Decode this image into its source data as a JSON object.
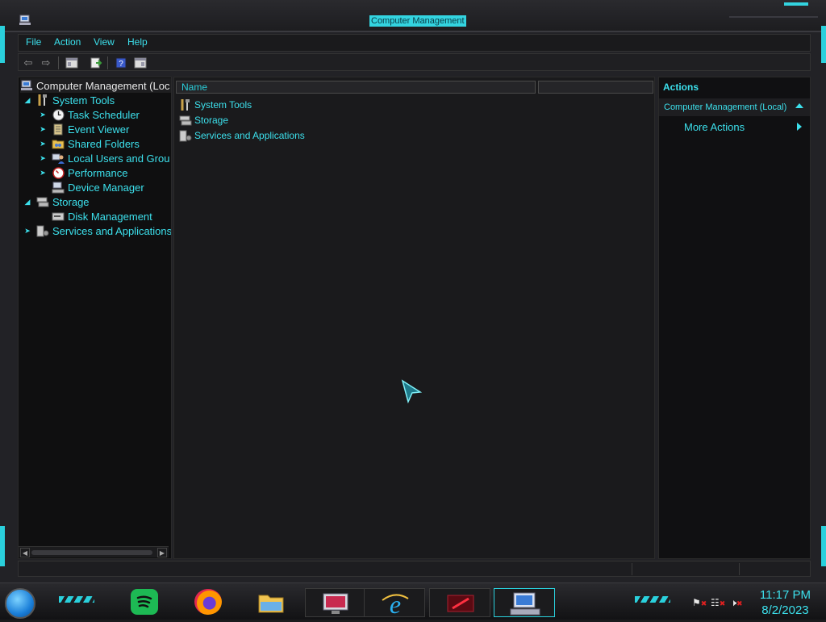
{
  "window": {
    "title": "Computer Management"
  },
  "menu": [
    "File",
    "Action",
    "View",
    "Help"
  ],
  "toolbar": {
    "icons": [
      "back-arrow-icon",
      "forward-arrow-icon",
      "show-hide-console-tree-icon",
      "export-list-icon",
      "help-icon",
      "show-hide-action-pane-icon"
    ]
  },
  "tree": {
    "root": "Computer Management (Loc",
    "items": [
      {
        "label": "System Tools",
        "level": 1,
        "expander": "expanded"
      },
      {
        "label": "Task Scheduler",
        "level": 2,
        "expander": "collapsed"
      },
      {
        "label": "Event Viewer",
        "level": 2,
        "expander": "collapsed"
      },
      {
        "label": "Shared Folders",
        "level": 2,
        "expander": "collapsed"
      },
      {
        "label": "Local Users and Grou",
        "level": 2,
        "expander": "collapsed"
      },
      {
        "label": "Performance",
        "level": 2,
        "expander": "collapsed"
      },
      {
        "label": "Device Manager",
        "level": 2,
        "expander": "none"
      },
      {
        "label": "Storage",
        "level": 1,
        "expander": "expanded"
      },
      {
        "label": "Disk Management",
        "level": 2,
        "expander": "none"
      },
      {
        "label": "Services and Applications",
        "level": 1,
        "expander": "collapsed"
      }
    ]
  },
  "list": {
    "column_name": "Name",
    "items": [
      "System Tools",
      "Storage",
      "Services and Applications"
    ]
  },
  "actions": {
    "title": "Actions",
    "section": "Computer Management (Local)",
    "more": "More Actions"
  },
  "taskbar": {
    "apps": [
      "spotify",
      "firefox",
      "file-explorer",
      "display-settings",
      "internet-explorer",
      "media-app",
      "computer-management"
    ]
  },
  "clock": {
    "time": "11:17 PM",
    "date": "8/2/2023"
  },
  "colors": {
    "accent": "#3ce0ec",
    "background": "#1a1a1c"
  }
}
